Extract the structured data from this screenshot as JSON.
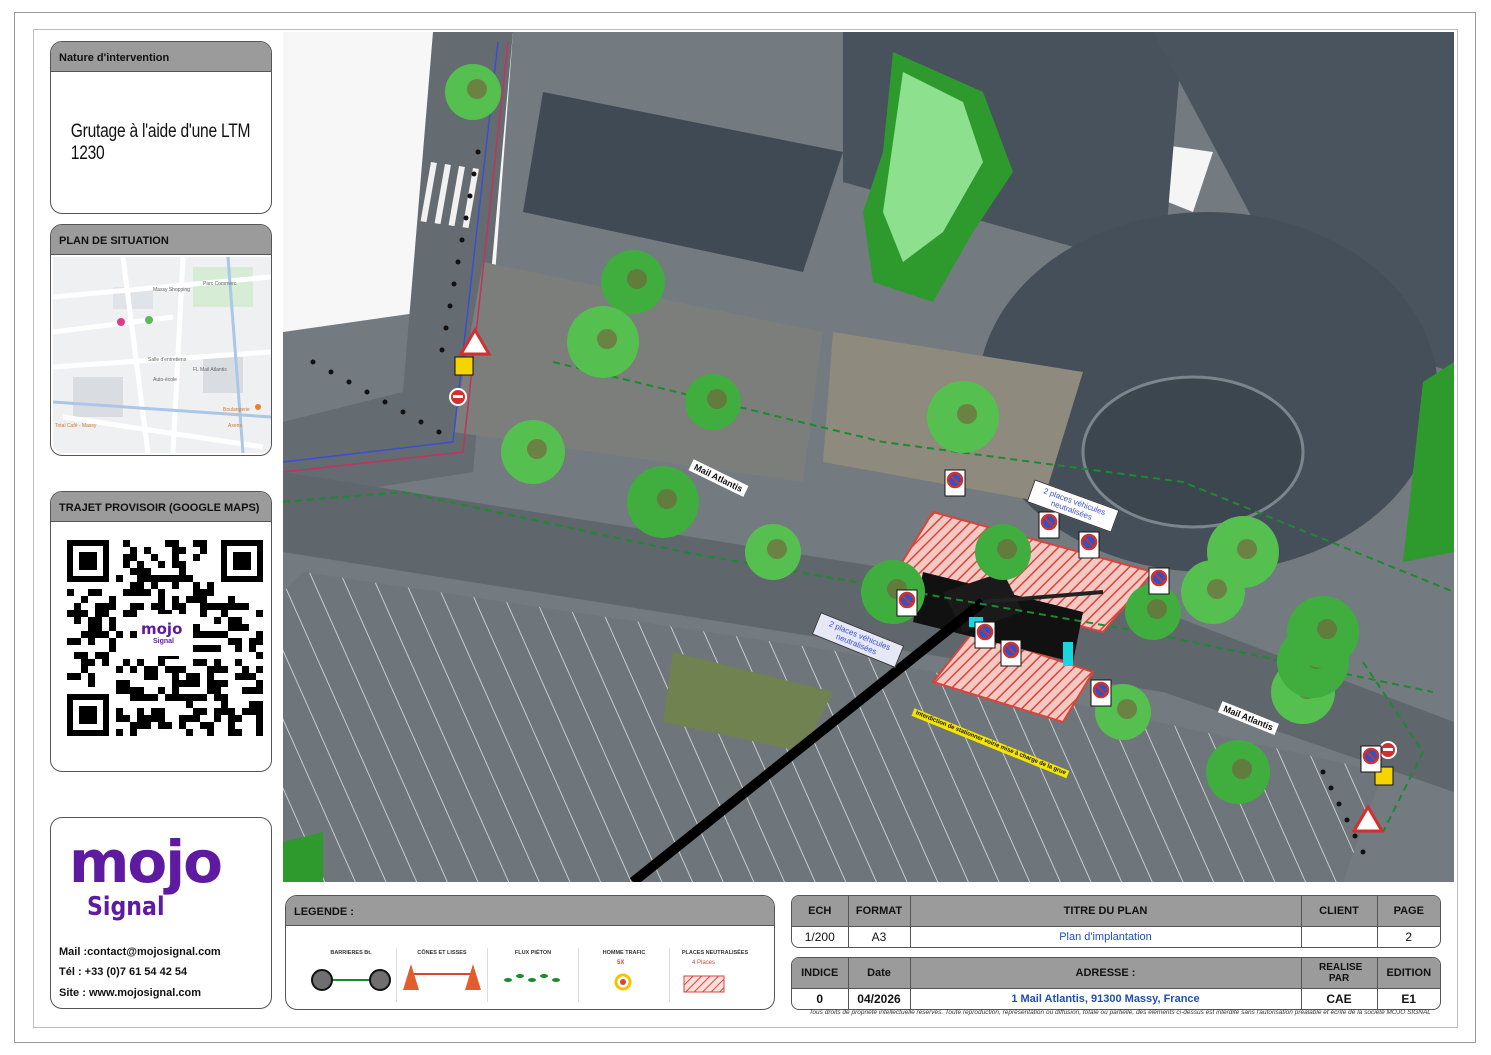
{
  "nature": {
    "title": "Nature d'intervention",
    "text": "Grutage à l'aide d'une LTM 1230"
  },
  "situation": {
    "title": "PLAN DE SITUATION",
    "map_labels": [
      "Parc Commerc",
      "Massy Shopping",
      "Salle d'entretiens",
      "FL Mail Atlantis",
      "Auto-école",
      "Boulangerie",
      "Total Café - Massy",
      "Axens"
    ]
  },
  "trajet": {
    "title": "TRAJET PROVISOIR (GOOGLE MAPS)"
  },
  "brand": {
    "logo_word": "mojo",
    "logo_sub": "Signal",
    "mail": "Mail :contact@mojosignal.com",
    "tel": "Tél : +33 (0)7 61 54 42 54",
    "site": "Site : www.mojosignal.com",
    "qr_word": "mojo",
    "qr_sub": "Signal"
  },
  "map": {
    "street_label_1": "Mail Atlantis",
    "street_label_2": "Mail Atlantis",
    "zone_label_1": "2 places véhicules neutralisées",
    "zone_label_2": "2 places véhicules neutralisées",
    "notice": "Interdiction de stationner voirie mise à charge de la grue"
  },
  "legend": {
    "title": "LEGENDE :",
    "items": [
      "BARRIERES Bt.",
      "CÔNES ET LISSES",
      "FLUX PIÉTON",
      "HOMME TRAFIC",
      "PLACES NEUTRALISÉES"
    ],
    "traffic_count": "5X",
    "places_count": "4 Places"
  },
  "title_block": {
    "row1_headers": [
      "ECH",
      "FORMAT",
      "TITRE DU PLAN",
      "CLIENT",
      "PAGE"
    ],
    "row1_values": [
      "1/200",
      "A3",
      "Plan d'implantation",
      "",
      "2"
    ],
    "row2_headers": [
      "INDICE",
      "Date",
      "ADRESSE :",
      "REALISE PAR",
      "EDITION"
    ],
    "row2_values": [
      "0",
      "04/2026",
      "1 Mail Atlantis, 91300 Massy, France",
      "CAE",
      "E1"
    ]
  },
  "copyright": "Tous droits de propriété intellectuelle réservés. Toute reproduction, représentation ou diffusion, totale ou partielle, des éléments ci-dessus est interdite sans l'autorisation préalable et écrite de la société MOJO SIGNAL",
  "colors": {
    "logo_purple": "#5e1aa0",
    "panel_header": "#9b9b9b",
    "address_blue": "#1d4fb3",
    "tree_green": "#3fae3f",
    "hatch_red": "#d9443a",
    "route_pink": "#d63bd6"
  }
}
